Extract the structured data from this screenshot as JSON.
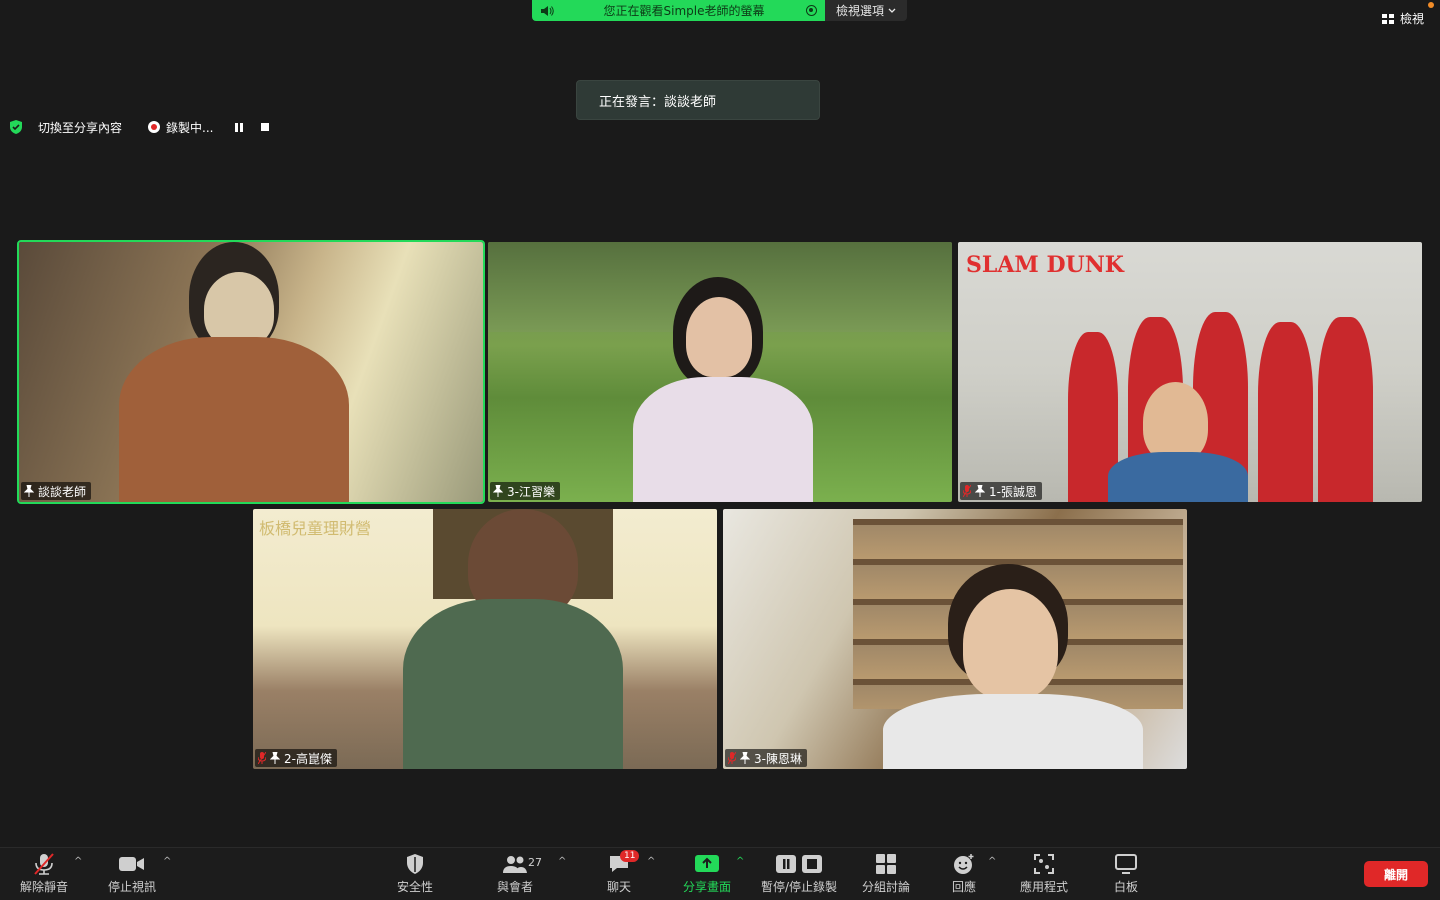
{
  "banner": {
    "share_text": "您正在觀看Simple老師的螢幕",
    "view_options": "檢視選項"
  },
  "top_right": {
    "view_label": "檢視"
  },
  "speaking": {
    "text": "正在發言：談談老師"
  },
  "recording": {
    "switch_label": "切換至分享內容",
    "recording_label": "錄製中..."
  },
  "tiles": [
    {
      "name": "談談老師",
      "muted": false,
      "active": true
    },
    {
      "name": "3-江習樂",
      "muted": false,
      "active": false
    },
    {
      "name": "1-張誠恩",
      "muted": true,
      "active": false,
      "bg_title": "SLAM DUNK"
    },
    {
      "name": "2-高崑傑",
      "muted": true,
      "active": false,
      "watermark": "板橋兒童理財營"
    },
    {
      "name": "3-陳恩琳",
      "muted": true,
      "active": false
    }
  ],
  "toolbar": {
    "unmute": "解除靜音",
    "stop_video": "停止視訊",
    "security": "安全性",
    "participants": "與會者",
    "participants_count": "27",
    "chat": "聊天",
    "chat_badge": "11",
    "share": "分享畫面",
    "record": "暫停/停止錄製",
    "breakout": "分組討論",
    "reactions": "回應",
    "apps": "應用程式",
    "whiteboard": "白板",
    "leave": "離開"
  },
  "colors": {
    "accent_green": "#23d959",
    "leave_red": "#e02828"
  }
}
